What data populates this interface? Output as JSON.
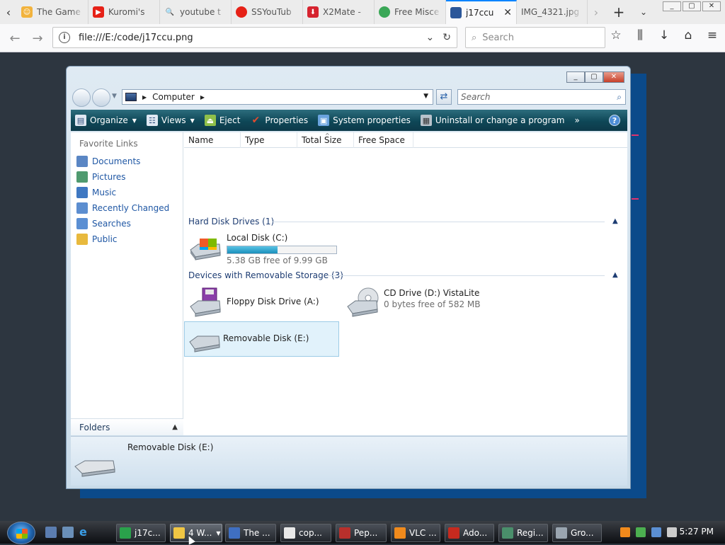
{
  "browser": {
    "tabs": [
      {
        "title": "The Game",
        "color": "#f2b33d"
      },
      {
        "title": "Kuromi's",
        "color": "#e62117"
      },
      {
        "title": "youtube t",
        "color": "#3a6fd8"
      },
      {
        "title": "SSYouTub",
        "color": "#e62117"
      },
      {
        "title": "X2Mate -",
        "color": "#d6232f"
      },
      {
        "title": "Free Misce",
        "color": "#3aa757"
      },
      {
        "title": "j17ccu",
        "color": "#2b579a"
      },
      {
        "title": "IMG_4321.jpg",
        "color": "#ffffff"
      }
    ],
    "url": "file:///E:/code/j17ccu.png",
    "search_placeholder": "Search"
  },
  "window": {
    "breadcrumb": [
      "Computer"
    ],
    "search_placeholder": "Search",
    "commands": [
      {
        "label": "Organize",
        "dropdown": true,
        "color": "#dfe8f3"
      },
      {
        "label": "Views",
        "dropdown": true,
        "color": "#dfe8f3"
      },
      {
        "label": "Eject",
        "dropdown": false,
        "color": "#8fbf4a"
      },
      {
        "label": "Properties",
        "dropdown": false,
        "color": "#e04b2f"
      },
      {
        "label": "System properties",
        "dropdown": false,
        "color": "#6aa3de"
      },
      {
        "label": "Uninstall or change a program",
        "dropdown": false,
        "color": "#b9c3cc"
      }
    ],
    "more": "»",
    "help": "?",
    "favorite_title": "Favorite Links",
    "favorites": [
      {
        "label": "Documents",
        "color": "#5a86c4"
      },
      {
        "label": "Pictures",
        "color": "#4f9a6f"
      },
      {
        "label": "Music",
        "color": "#3f78c2"
      },
      {
        "label": "Recently Changed",
        "color": "#5c8ed0"
      },
      {
        "label": "Searches",
        "color": "#5b8fd3"
      },
      {
        "label": "Public",
        "color": "#e8b93d"
      }
    ],
    "folders_label": "Folders",
    "columns": [
      "Name",
      "Type",
      "Total Size",
      "Free Space"
    ],
    "groups": [
      {
        "header": "Hard Disk Drives (1)",
        "drives": [
          {
            "name": "Local Disk (C:)",
            "sub": "5.38 GB free of 9.99 GB",
            "used_fraction": 0.46
          }
        ]
      },
      {
        "header": "Devices with Removable Storage (3)",
        "drives": [
          {
            "name": "Floppy Disk Drive (A:)",
            "sub": ""
          },
          {
            "name": "CD Drive (D:) VistaLite",
            "sub": "0 bytes free of 582 MB"
          },
          {
            "name": "Removable Disk (E:)",
            "sub": "",
            "selected": true
          }
        ]
      }
    ],
    "details_name": "Removable Disk (E:)"
  },
  "taskbar": {
    "items": [
      {
        "label": "j17c...",
        "color": "#2aa14b"
      },
      {
        "label": "4 W...",
        "color": "#f0c644",
        "active": true
      },
      {
        "label": "The ...",
        "color": "#3f6fc2"
      },
      {
        "label": "cop...",
        "color": "#e8e8e8"
      },
      {
        "label": "Pep...",
        "color": "#b8302c"
      },
      {
        "label": "VLC ...",
        "color": "#f08a1c"
      },
      {
        "label": "Ado...",
        "color": "#c62a1f"
      },
      {
        "label": "Regi...",
        "color": "#4a8f6b"
      },
      {
        "label": "Gro...",
        "color": "#9aa5b0"
      }
    ],
    "clock": "5:27 PM"
  }
}
